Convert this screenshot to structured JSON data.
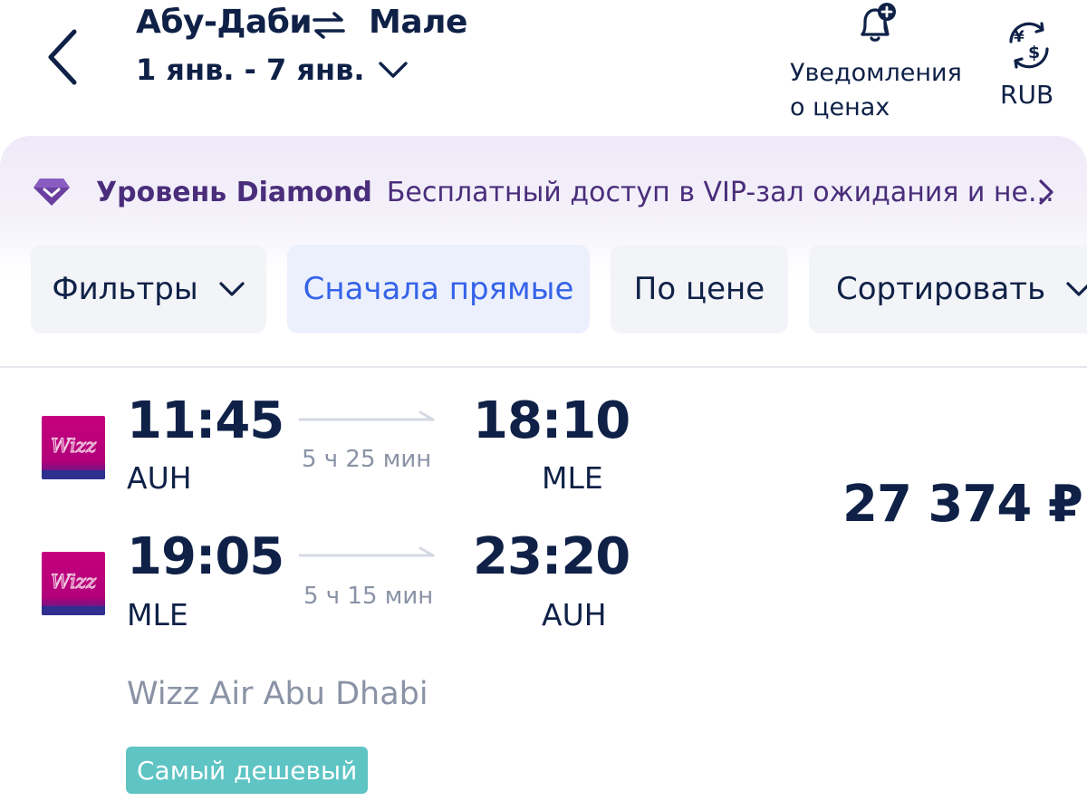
{
  "header": {
    "origin": "Абу-Даби",
    "destination": "Мале",
    "dates": "1 янв. - 7 янв.",
    "alerts_label_line1": "Уведомления",
    "alerts_label_line2": "о ценах",
    "currency": "RUB",
    "icons": [
      "back-arrow-icon",
      "swap-arrows-icon",
      "chevron-down-icon",
      "bell-plus-icon",
      "currency-exchange-icon"
    ]
  },
  "banner": {
    "level": "Уровень Diamond",
    "text": "Бесплатный доступ в VIP-зал ожидания и не...",
    "accent_color": "#4a2d7b"
  },
  "filters": {
    "filters_label": "Фильтры",
    "direct_label": "Сначала прямые",
    "price_label": "По цене",
    "sort_label": "Сортировать",
    "active_color": "#3563e9"
  },
  "flight": {
    "outbound": {
      "departure_time": "11:45",
      "departure_code": "AUH",
      "duration": "5 ч 25 мин",
      "arrival_time": "18:10",
      "arrival_code": "MLE"
    },
    "return": {
      "departure_time": "19:05",
      "departure_code": "MLE",
      "duration": "5 ч 15 мин",
      "arrival_time": "23:20",
      "arrival_code": "AUH"
    },
    "logo_text": "Wizz",
    "price": "27 374 ₽",
    "airline": "Wizz Air Abu Dhabi",
    "badge": "Самый дешевый",
    "badge_color": "#5ec4c4"
  }
}
